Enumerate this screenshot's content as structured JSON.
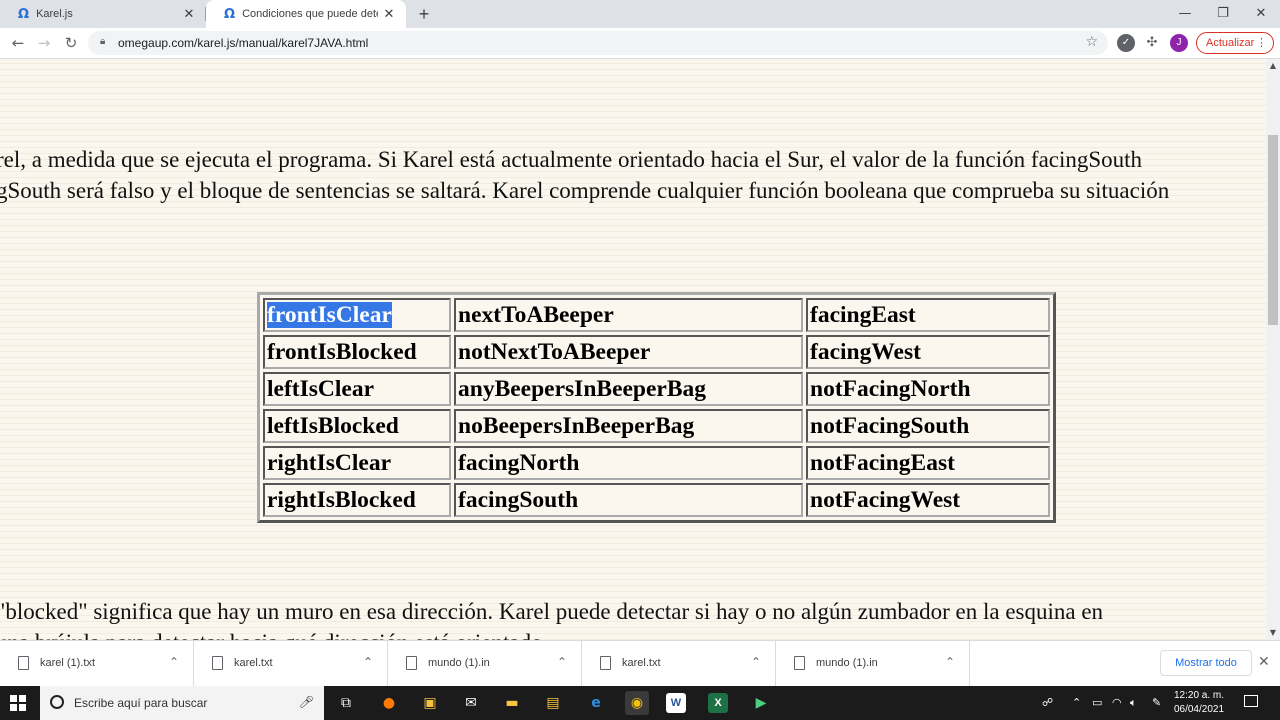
{
  "browser": {
    "tabs": [
      {
        "title": "Karel.js",
        "favicon": "omega-icon",
        "active": false
      },
      {
        "title": "Condiciones que puede detectar",
        "favicon": "omega-icon",
        "active": true
      }
    ],
    "new_tab": "+",
    "window_controls": {
      "minimize": "—",
      "maximize": "❐",
      "close": "✕"
    },
    "nav": {
      "back": "←",
      "forward": "→",
      "reload": "↻"
    },
    "url": "omegaup.com/karel.js/manual/karel7JAVA.html",
    "update_button": "Actualizar",
    "avatar_letter": "J",
    "accent_color": "#d93025"
  },
  "page": {
    "paragraphs": [
      "rel, a medida que se ejecuta el programa. Si Karel está actualmente orientado hacia el Sur, el valor de la función facingSouth",
      "gSouth será falso y el bloque de sentencias se saltará. Karel comprende cualquier función booleana que comprueba su situación",
      "\"blocked\" significa que hay un muro en esa dirección. Karel puede detectar si hay o no algún zumbador en la esquina en",
      "una brújula para detectar hacia qué dirección está orientado."
    ],
    "conditions_table": [
      [
        "frontIsClear",
        "nextToABeeper",
        "facingEast"
      ],
      [
        "frontIsBlocked",
        "notNextToABeeper",
        "facingWest"
      ],
      [
        "leftIsClear",
        "anyBeepersInBeeperBag",
        "notFacingNorth"
      ],
      [
        "leftIsBlocked",
        "noBeepersInBeeperBag",
        "notFacingSouth"
      ],
      [
        "rightIsClear",
        "facingNorth",
        "notFacingEast"
      ],
      [
        "rightIsBlocked",
        "facingSouth",
        "notFacingWest"
      ]
    ],
    "selected_cell": "frontIsClear"
  },
  "downloads": {
    "items": [
      "karel (1).txt",
      "karel.txt",
      "mundo (1).in",
      "karel.txt",
      "mundo (1).in"
    ],
    "show_all": "Mostrar todo"
  },
  "taskbar": {
    "search_placeholder": "Escribe aquí para buscar",
    "apps": [
      "task-view",
      "firefox",
      "store",
      "mail",
      "file-explorer",
      "files",
      "edge",
      "chrome",
      "word",
      "excel",
      "app"
    ],
    "time": "12:20 a. m.",
    "date": "06/04/2021"
  }
}
